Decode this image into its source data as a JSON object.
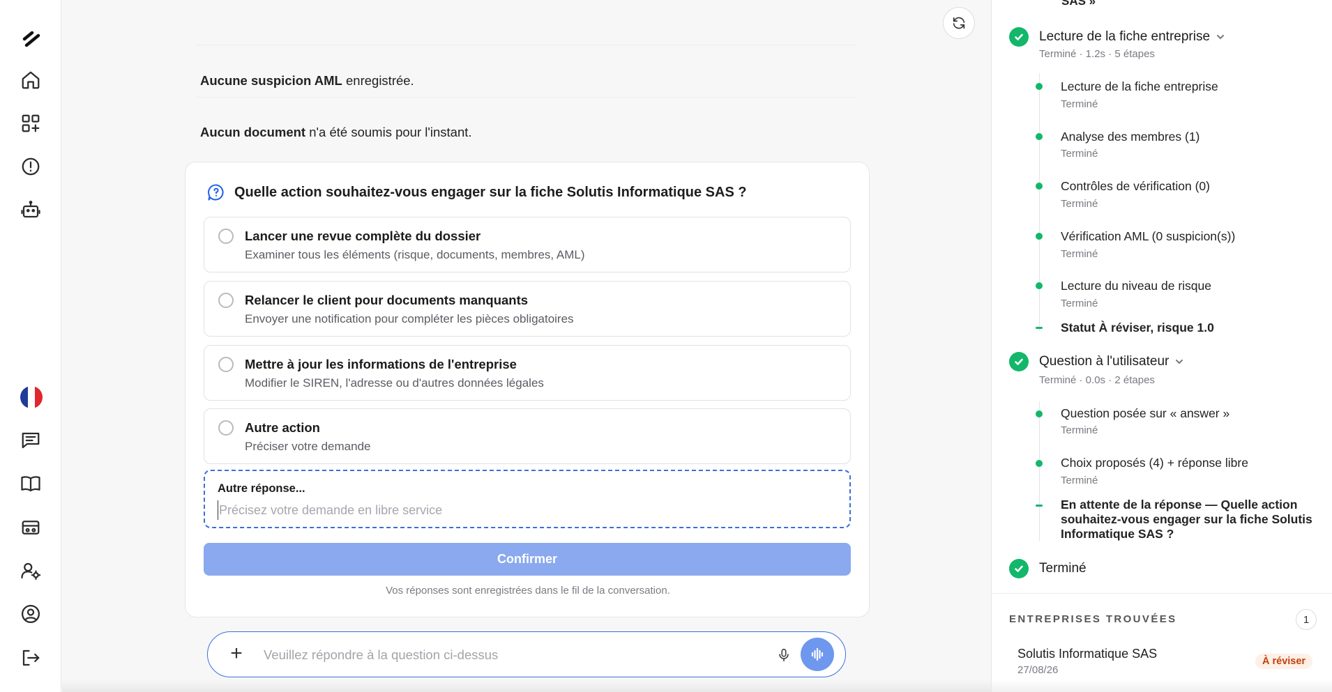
{
  "sidebar": {
    "items": [
      {
        "icon": "logo-icon"
      },
      {
        "icon": "home-icon"
      },
      {
        "icon": "apps-add-icon"
      },
      {
        "icon": "alert-circle-icon"
      },
      {
        "icon": "robot-icon"
      },
      {
        "icon": "french-flag-icon"
      },
      {
        "icon": "chat-icon"
      },
      {
        "icon": "book-icon"
      },
      {
        "icon": "id-card-icon"
      },
      {
        "icon": "user-settings-icon"
      },
      {
        "icon": "user-circle-icon"
      },
      {
        "icon": "logout-icon"
      }
    ]
  },
  "main": {
    "info1": {
      "bold": "Aucune suspicion AML",
      "rest": " enregistrée."
    },
    "info2": {
      "bold": "Aucun document",
      "rest": " n'a été soumis pour l'instant."
    },
    "question": {
      "title": "Quelle action souhaitez-vous engager sur la fiche Solutis Informatique SAS ?",
      "options": [
        {
          "title": "Lancer une revue complète du dossier",
          "desc": "Examiner tous les éléments (risque, documents, membres, AML)"
        },
        {
          "title": "Relancer le client pour documents manquants",
          "desc": "Envoyer une notification pour compléter les pièces obligatoires"
        },
        {
          "title": "Mettre à jour les informations de l'entreprise",
          "desc": "Modifier le SIREN, l'adresse ou d'autres données légales"
        },
        {
          "title": "Autre action",
          "desc": "Préciser votre demande"
        }
      ],
      "other_label": "Autre réponse...",
      "other_placeholder": "Précisez votre demande en libre service",
      "confirm_label": "Confirmer",
      "note": "Vos réponses sont enregistrées dans le fil de la conversation."
    },
    "composer": {
      "placeholder": "Veuillez répondre à la question ci-dessus"
    }
  },
  "right_panel": {
    "cut_top": "SAS »",
    "steps": [
      {
        "title": "Lecture de la fiche entreprise",
        "meta": "Terminé · 1.2s · 5 étapes",
        "subs": [
          {
            "title": "Lecture de la fiche entreprise",
            "status": "Terminé"
          },
          {
            "title": "Analyse des membres (1)",
            "status": "Terminé"
          },
          {
            "title": "Contrôles de vérification (0)",
            "status": "Terminé"
          },
          {
            "title": "Vérification AML (0 suspicion(s))",
            "status": "Terminé"
          },
          {
            "title": "Lecture du niveau de risque",
            "status": "Terminé"
          },
          {
            "title": "Statut À réviser, risque 1.0"
          }
        ]
      },
      {
        "title": "Question à l'utilisateur",
        "meta": "Terminé · 0.0s · 2 étapes",
        "subs": [
          {
            "title": "Question posée sur « answer »",
            "status": "Terminé"
          },
          {
            "title": "Choix proposés (4) + réponse libre",
            "status": "Terminé"
          },
          {
            "title": "En attente de la réponse — Quelle action souhaitez-vous engager sur la fiche Solutis Informatique SAS ?"
          }
        ]
      },
      {
        "title": "Terminé"
      }
    ],
    "companies": {
      "heading": "ENTREPRISES TROUVÉES",
      "count": "1",
      "items": [
        {
          "name": "Solutis Informatique SAS",
          "date": "27/08/26",
          "badge": "À réviser"
        }
      ]
    }
  },
  "colors": {
    "accent": "#3b6fd8",
    "confirm_disabled": "#8aa9ef",
    "success": "#12b76a",
    "badge_text": "#c2410c",
    "badge_bg": "#fdf0e6"
  }
}
